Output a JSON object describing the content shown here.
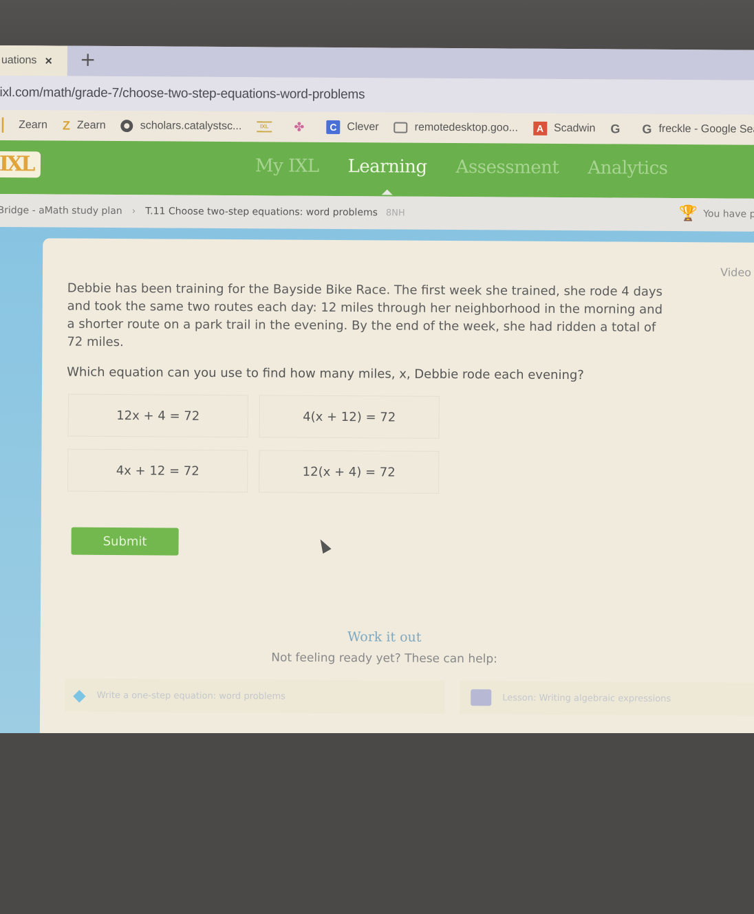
{
  "browser": {
    "tab": {
      "title": "uations",
      "close_label": "×"
    },
    "new_tab_label": "+",
    "url": "ixl.com/math/grade-7/choose-two-step-equations-word-problems",
    "bookmarks": [
      {
        "icon": "zearn-icon",
        "glyph": "",
        "label": "Zearn"
      },
      {
        "icon": "zearn-icon",
        "glyph": "Z",
        "label": "Zearn"
      },
      {
        "icon": "globe-icon",
        "glyph": "",
        "label": "scholars.catalystsc..."
      },
      {
        "icon": "ixl-icon",
        "glyph": "IXL",
        "label": ""
      },
      {
        "icon": "pinwheel-icon",
        "glyph": "✤",
        "label": ""
      },
      {
        "icon": "clever-icon",
        "glyph": "C",
        "label": "Clever"
      },
      {
        "icon": "remote-desktop-icon",
        "glyph": "",
        "label": "remotedesktop.goo..."
      },
      {
        "icon": "scadwin-icon",
        "glyph": "A",
        "label": "Scadwin"
      },
      {
        "icon": "google-icon",
        "glyph": "G",
        "label": ""
      },
      {
        "icon": "google-icon",
        "glyph": "G",
        "label": "freckle - Google Sea..."
      }
    ]
  },
  "ixl": {
    "logo": "IXL",
    "nav": [
      {
        "label": "My IXL",
        "active": false
      },
      {
        "label": "Learning",
        "active": true
      },
      {
        "label": "Assessment",
        "active": false
      },
      {
        "label": "Analytics",
        "active": false
      }
    ],
    "breadcrumb": {
      "plan": "Bridge - aMath study plan",
      "separator": "›",
      "skill": "T.11 Choose two-step equations: word problems",
      "code": "8NH"
    },
    "award_text": "You have p"
  },
  "practice": {
    "video_label": "Video",
    "problem": "Debbie has been training for the Bayside Bike Race. The first week she trained, she rode 4 days and took the same two routes each day: 12 miles through her neighborhood in the morning and a shorter route on a park trail in the evening. By the end of the week, she had ridden a total of 72 miles.",
    "question": "Which equation can you use to find how many miles, x, Debbie rode each evening?",
    "choices": [
      "12x + 4 = 72",
      "4(x + 12) = 72",
      "4x + 12 = 72",
      "12(x + 4) = 72"
    ],
    "submit_label": "Submit",
    "work_it_out": {
      "title": "Work it out",
      "subtitle": "Not feeling ready yet? These can help:",
      "resources": [
        {
          "icon": "diamond-icon",
          "label": "Write a one-step equation: word problems"
        },
        {
          "icon": "lesson-icon",
          "label": "Lesson: Writing algebraic expressions"
        }
      ]
    }
  },
  "colors": {
    "ixl_green": "#6ab04c",
    "practice_blue": "#88c4e2",
    "submit_green": "#72b84e"
  }
}
